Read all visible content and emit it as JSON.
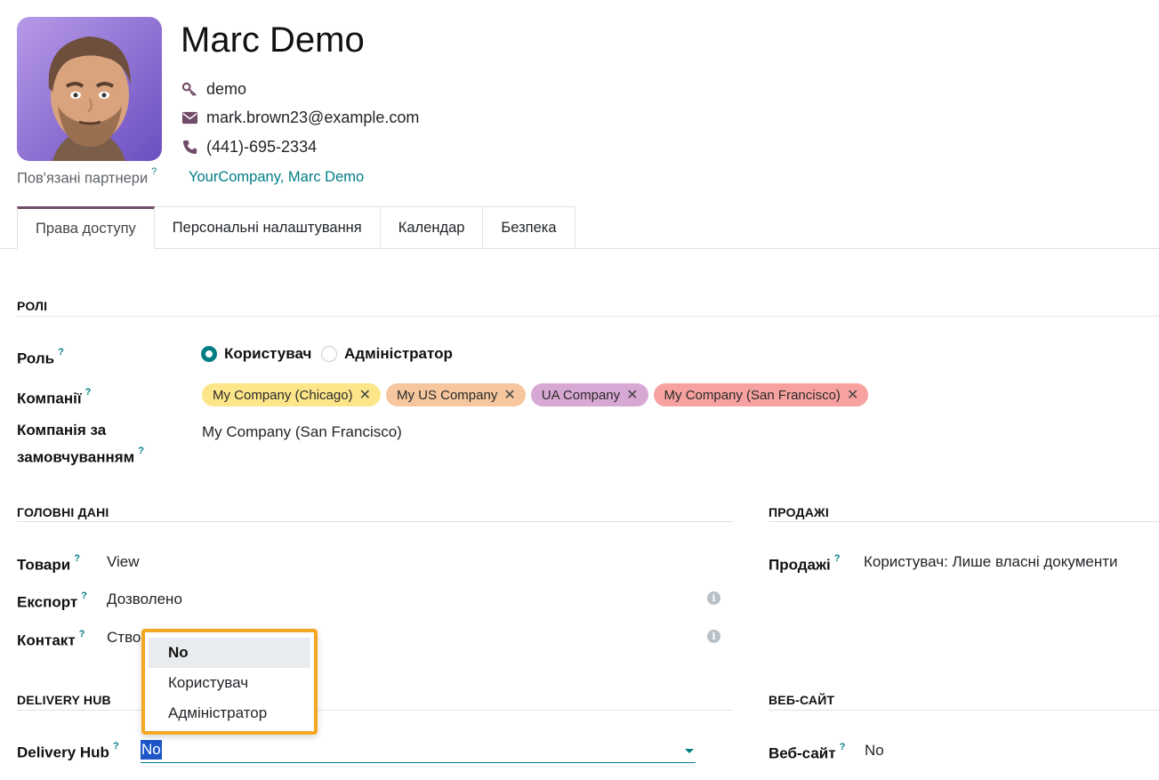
{
  "user": {
    "name": "Marc Demo",
    "login": "demo",
    "email": "mark.brown23@example.com",
    "phone": "(441)-695-2334",
    "related_label": "Пов'язані партнери",
    "related_value": "YourCompany, Marc Demo"
  },
  "tabs": [
    {
      "label": "Права доступу",
      "active": true
    },
    {
      "label": "Персональні налаштування",
      "active": false
    },
    {
      "label": "Календар",
      "active": false
    },
    {
      "label": "Безпека",
      "active": false
    }
  ],
  "roles_section": {
    "title": "РОЛІ",
    "role_label": "Роль",
    "role_options": [
      "Користувач",
      "Адміністратор"
    ],
    "role_selected": "Користувач",
    "companies_label": "Компанії",
    "companies": [
      {
        "name": "My Company (Chicago)",
        "color": "#fde68a"
      },
      {
        "name": "My US Company",
        "color": "#f6c79e"
      },
      {
        "name": "UA Company",
        "color": "#d8a8d4"
      },
      {
        "name": "My Company (San Francisco)",
        "color": "#f7a2a0"
      }
    ],
    "default_company_label_line1": "Компанія за",
    "default_company_label_line2": "замовчуванням",
    "default_company_value": "My Company (San Francisco)"
  },
  "main_data": {
    "title": "ГОЛОВНІ ДАНІ",
    "products_label": "Товари",
    "products_value": "View",
    "export_label": "Експорт",
    "export_value": "Дозволено",
    "contact_label": "Контакт",
    "contact_value": "Ство"
  },
  "sales": {
    "title": "ПРОДАЖІ",
    "label": "Продажі",
    "value": "Користувач: Лише власні документи"
  },
  "delivery": {
    "title": "DELIVERY HUB",
    "label": "Delivery Hub",
    "value": "No"
  },
  "website": {
    "title": "ВЕБ-САЙТ",
    "label": "Веб-сайт",
    "value": "No"
  },
  "dropdown": {
    "options": [
      "No",
      "Користувач",
      "Адміністратор"
    ],
    "selected": "No"
  },
  "colors": {
    "accent": "#017e84",
    "tab_active": "#714b67",
    "highlight": "#f5a623"
  }
}
